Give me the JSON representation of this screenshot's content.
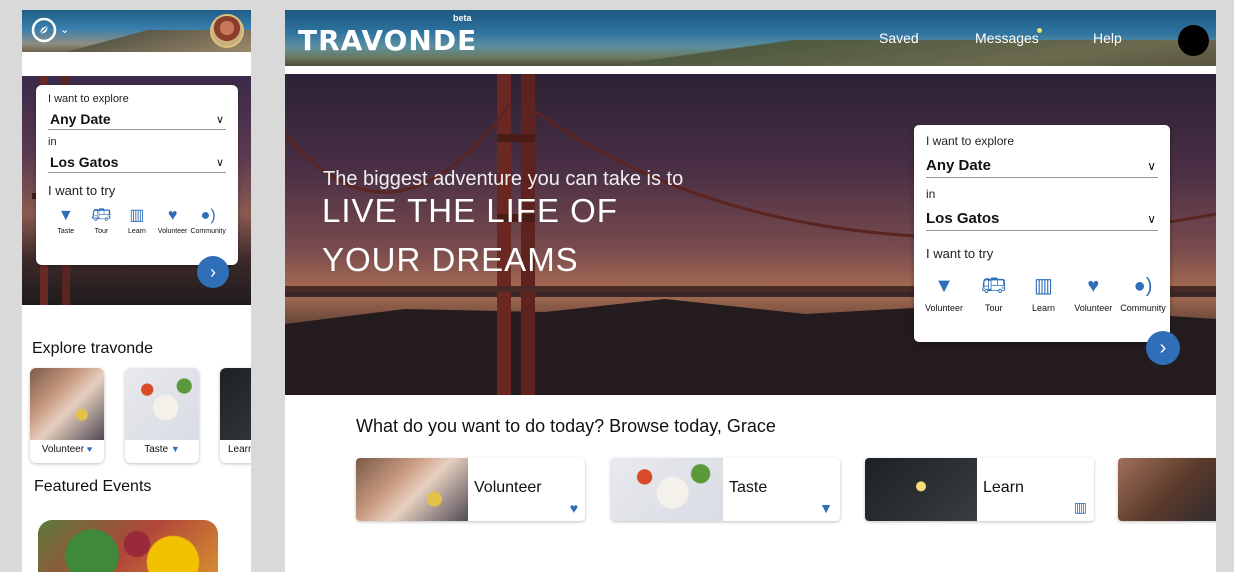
{
  "mobile": {
    "search": {
      "explore_label": "I want to explore",
      "date_value": "Any Date",
      "in_label": "in",
      "location_value": "Los Gatos",
      "try_label": "I want to try",
      "categories": [
        {
          "label": "Taste",
          "icon": "ice-cream-icon"
        },
        {
          "label": "Tour",
          "icon": "bus-icon"
        },
        {
          "label": "Learn",
          "icon": "book-icon"
        },
        {
          "label": "Volunteer",
          "icon": "heart-icon"
        },
        {
          "label": "Community",
          "icon": "community-icon"
        }
      ]
    },
    "explore_title": "Explore travonde",
    "explore_tiles": [
      {
        "label": "Volunteer",
        "icon": "heart-icon"
      },
      {
        "label": "Taste",
        "icon": "ice-cream-icon"
      },
      {
        "label": "Learn",
        "icon": "book-icon"
      }
    ],
    "featured_title": "Featured Events"
  },
  "desktop": {
    "logo": "TRAVONDE",
    "beta": "beta",
    "nav": {
      "saved": "Saved",
      "messages": "Messages",
      "help": "Help"
    },
    "hero": {
      "line1": "The biggest adventure you can take is to",
      "line2": "LIVE THE LIFE OF",
      "line3": "YOUR DREAMS"
    },
    "search": {
      "explore_label": "I want to explore",
      "date_value": "Any Date",
      "in_label": "in",
      "location_value": "Los Gatos",
      "try_label": "I want to try",
      "categories": [
        {
          "label": "Volunteer",
          "icon": "ice-cream-icon"
        },
        {
          "label": "Tour",
          "icon": "bus-icon"
        },
        {
          "label": "Learn",
          "icon": "book-icon"
        },
        {
          "label": "Volunteer",
          "icon": "heart-icon"
        },
        {
          "label": "Community",
          "icon": "community-icon"
        }
      ]
    },
    "browse_title": "What do you want to do today? Browse today, Grace",
    "browse_tiles": [
      {
        "label": "Volunteer",
        "icon": "heart-icon"
      },
      {
        "label": "Taste",
        "icon": "ice-cream-icon"
      },
      {
        "label": "Learn",
        "icon": "book-icon"
      },
      {
        "label": "",
        "icon": ""
      }
    ]
  },
  "colors": {
    "accent": "#2f6fb8",
    "notification": "#e8e84a"
  }
}
